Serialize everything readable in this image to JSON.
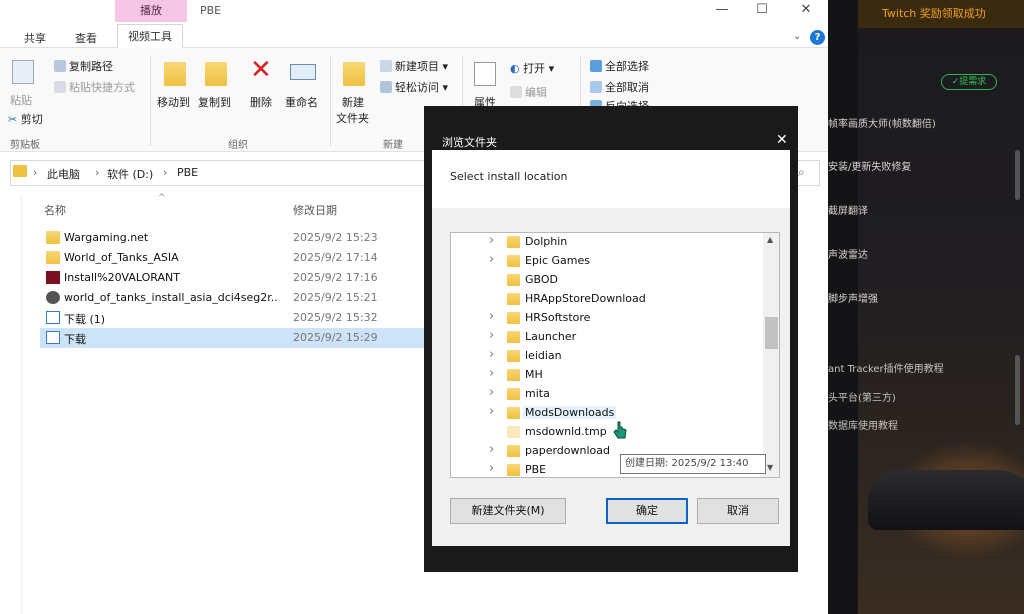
{
  "app_panel": {
    "banner": "Twitch 奖励领取成功",
    "badge": "✓提需求",
    "menu": [
      "帧率画质大师(帧数翻倍)",
      "安装/更新失败修复",
      "截屏翻译",
      "声波雷达",
      "脚步声增强",
      "ant Tracker插件使用教程",
      "头平台(第三方)",
      "数据库使用教程"
    ]
  },
  "explorer": {
    "context_tab": "播放",
    "title": "PBE",
    "ribbon_tabs": [
      "共享",
      "查看",
      "视频工具"
    ],
    "clipboard": {
      "paste": "粘贴",
      "copy_path": "复制路径",
      "paste_shortcut": "粘贴快捷方式",
      "cut": "剪切",
      "group": "剪贴板"
    },
    "organize": {
      "move_to": "移动到",
      "copy_to": "复制到",
      "delete": "删除",
      "rename": "重命名",
      "group": "组织"
    },
    "new": {
      "new_folder": "新建",
      "new_folder2": "文件夹",
      "new_item": "新建项目",
      "easy_access": "轻松访问",
      "group": "新建"
    },
    "open": {
      "properties": "属性",
      "open": "打开",
      "edit": "编辑"
    },
    "select": {
      "select_all": "全部选择",
      "select_none": "全部取消",
      "invert": "反向选择"
    },
    "breadcrumb": [
      "此电脑",
      "软件 (D:)",
      "PBE"
    ],
    "columns": {
      "name": "名称",
      "modified": "修改日期"
    },
    "files": [
      {
        "name": "Wargaming.net",
        "date": "2025/9/2 15:23",
        "icon": "folder-icon"
      },
      {
        "name": "World_of_Tanks_ASIA",
        "date": "2025/9/2 17:14",
        "icon": "folder-icon"
      },
      {
        "name": "Install%20VALORANT",
        "date": "2025/9/2 17:16",
        "icon": "valorant-icon"
      },
      {
        "name": "world_of_tanks_install_asia_dci4seg2r...",
        "date": "2025/9/2 15:21",
        "icon": "installer-icon"
      },
      {
        "name": "下载 (1)",
        "date": "2025/9/2 15:32",
        "icon": "document-icon"
      },
      {
        "name": "下载",
        "date": "2025/9/2 15:29",
        "icon": "document-icon",
        "selected": true
      }
    ]
  },
  "dialog": {
    "title": "浏览文件夹",
    "prompt": "Select install location",
    "tree": [
      {
        "label": "Dolphin",
        "expandable": true
      },
      {
        "label": "Epic Games",
        "expandable": true
      },
      {
        "label": "GBOD",
        "expandable": false
      },
      {
        "label": "HRAppStoreDownload",
        "expandable": false
      },
      {
        "label": "HRSoftstore",
        "expandable": true
      },
      {
        "label": "Launcher",
        "expandable": true
      },
      {
        "label": "leidian",
        "expandable": true
      },
      {
        "label": "MH",
        "expandable": true
      },
      {
        "label": "mita",
        "expandable": true
      },
      {
        "label": "ModsDownloads",
        "expandable": true,
        "hover": true
      },
      {
        "label": "msdownld.tmp",
        "expandable": false,
        "tmp": true
      },
      {
        "label": "paperdownload",
        "expandable": true
      },
      {
        "label": "PBE",
        "expandable": true
      }
    ],
    "tooltip": "创建日期: 2025/9/2 13:40",
    "new_folder_button": "新建文件夹(M)",
    "ok_button": "确定",
    "cancel_button": "取消"
  }
}
